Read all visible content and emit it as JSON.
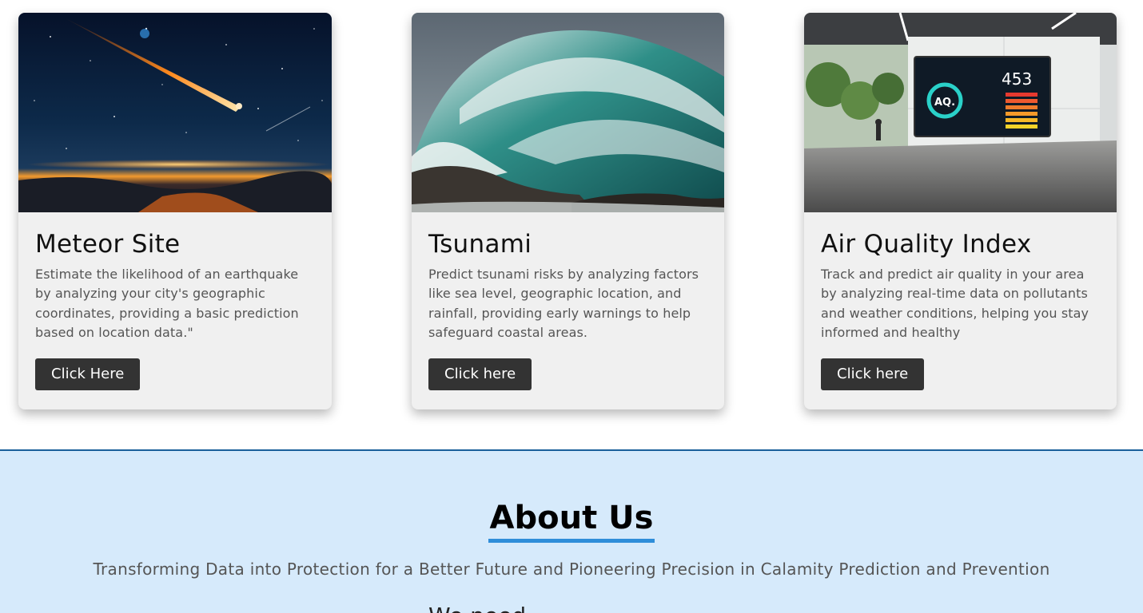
{
  "cards": [
    {
      "title": "Meteor Site",
      "description": "Estimate the likelihood of an earthquake by analyzing your city's geographic coordinates, providing a basic prediction based on location data.\"",
      "button_label": "Click Here",
      "image_icon": "meteor-night-sky-image"
    },
    {
      "title": "Tsunami",
      "description": "Predict tsunami risks by analyzing factors like sea level, geographic location, and rainfall, providing early warnings to help safeguard coastal areas.",
      "button_label": "Click here",
      "image_icon": "ocean-wave-image"
    },
    {
      "title": "Air Quality Index",
      "description": "Track and predict air quality in your area by analyzing real-time data on pollutants and weather conditions, helping you stay informed and healthy",
      "button_label": "Click here",
      "image_icon": "aqi-display-station-image",
      "image_text": {
        "aqi_value": "453",
        "aqi_badge": "AQ."
      }
    }
  ],
  "about": {
    "title": "About Us",
    "subtitle": "Transforming Data into Protection for a Better Future and Pioneering Precision in Calamity Prediction and Prevention",
    "next_heading_partial": "We need"
  },
  "colors": {
    "button_bg": "#333333",
    "card_bg": "#f0f0f0",
    "about_bg": "#d6eafb",
    "about_underline": "#2f8ed9",
    "section_border": "#1a5f9a"
  }
}
